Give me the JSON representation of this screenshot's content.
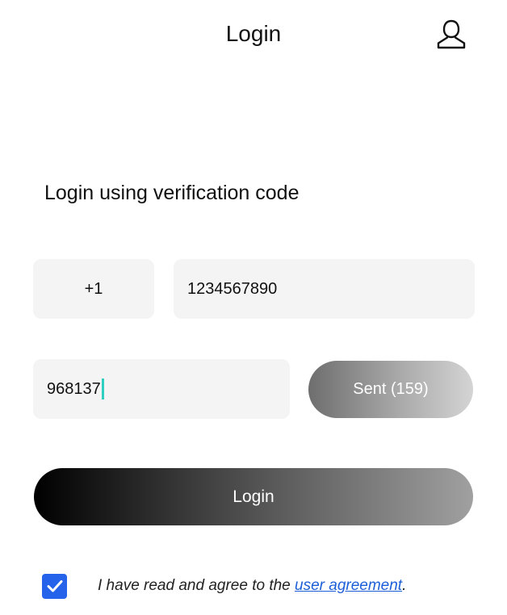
{
  "header": {
    "title": "Login",
    "account_icon": "user-icon"
  },
  "form": {
    "section_title": "Login using verification code",
    "country_code": "+1",
    "phone_number": "1234567890",
    "verification_code": "968137",
    "sent_button_label": "Sent (159)",
    "login_button_label": "Login"
  },
  "agreement": {
    "checked": true,
    "text_before": "I have read and agree to the ",
    "link_text": "user agreement",
    "text_after": "."
  },
  "colors": {
    "caret": "#2ecfc0",
    "checkbox": "#2563eb",
    "link": "#1d5fd8",
    "field_background": "#f4f4f4"
  }
}
